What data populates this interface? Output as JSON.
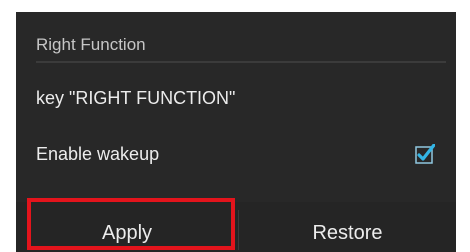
{
  "dialog": {
    "title": "Right Function",
    "key_label": "key \"RIGHT FUNCTION\"",
    "wakeup": {
      "label": "Enable wakeup",
      "checked": true
    },
    "buttons": {
      "apply": "Apply",
      "restore": "Restore"
    }
  },
  "colors": {
    "dialog_bg": "#282828",
    "accent_check": "#33b5e5",
    "highlight": "#e3141c"
  }
}
